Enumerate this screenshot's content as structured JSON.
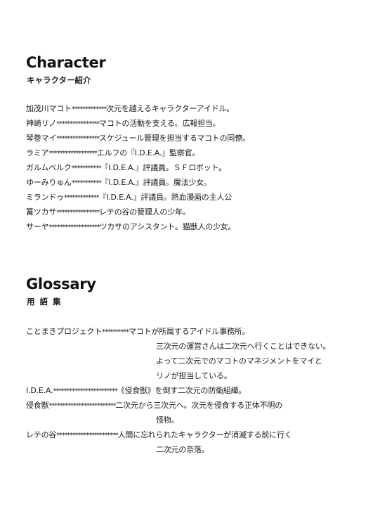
{
  "character": {
    "title": "Character",
    "subtitle": "キャラクター紹介",
    "entries": [
      {
        "name": "加茂川マコト",
        "stars": "*************",
        "desc": "次元を越えるキャラクターアイドル。"
      },
      {
        "name": "神崎リノ",
        "stars": "****************",
        "desc": "マコトの活動を支える。広報担当。"
      },
      {
        "name": "琴巻マイ",
        "stars": "****************",
        "desc": "スケジュール管理を担当するマコトの同僚。"
      },
      {
        "name": "ラミア",
        "stars": "******************",
        "desc": "エルフの『I.D.E.A.』監察官。"
      },
      {
        "name": "ガルムベルク",
        "stars": "***********",
        "desc": "『I.D.E.A.』評議員。ＳＦロボット。"
      },
      {
        "name": "ゆーみりゅん",
        "stars": "***********",
        "desc": "『I.D.E.A.』評議員。魔法少女。"
      },
      {
        "name": "ミランドゥ",
        "stars": "*************",
        "desc": "『I.D.E.A.』評議員。熱血漫画の主人公"
      },
      {
        "name": "篝ツカサ",
        "stars": "****************",
        "desc": "レテの谷の管理人の少年。"
      },
      {
        "name": "サーヤ",
        "stars": "*******************",
        "desc": "ツカサのアシスタント。猫獣人の少女。"
      }
    ]
  },
  "glossary": {
    "title": "Glossary",
    "subtitle": "用語集",
    "entries": [
      {
        "term": "ことまきプロジェクト",
        "stars": "**********",
        "lines": [
          "マコトが所属するアイドル事務所。",
          "三次元の運営さんは二次元へ行くことはできない。",
          "よって二次元でのマコトのマネジメントをマイと",
          "リノが担当している。"
        ]
      },
      {
        "term": "I.D.E.A.",
        "stars": "************************",
        "lines": [
          "《侵食獣》を倒す二次元の防衛組織。"
        ]
      },
      {
        "term": "侵食獣",
        "stars": "*************************",
        "lines": [
          "二次元から三次元へ。次元を侵食する正体不明の",
          "怪物。"
        ]
      },
      {
        "term": "レテの谷",
        "stars": "***********************",
        "lines": [
          "人間に忘れられたキャラクターが消滅する前に行く",
          "二次元の奈落。"
        ]
      }
    ]
  }
}
